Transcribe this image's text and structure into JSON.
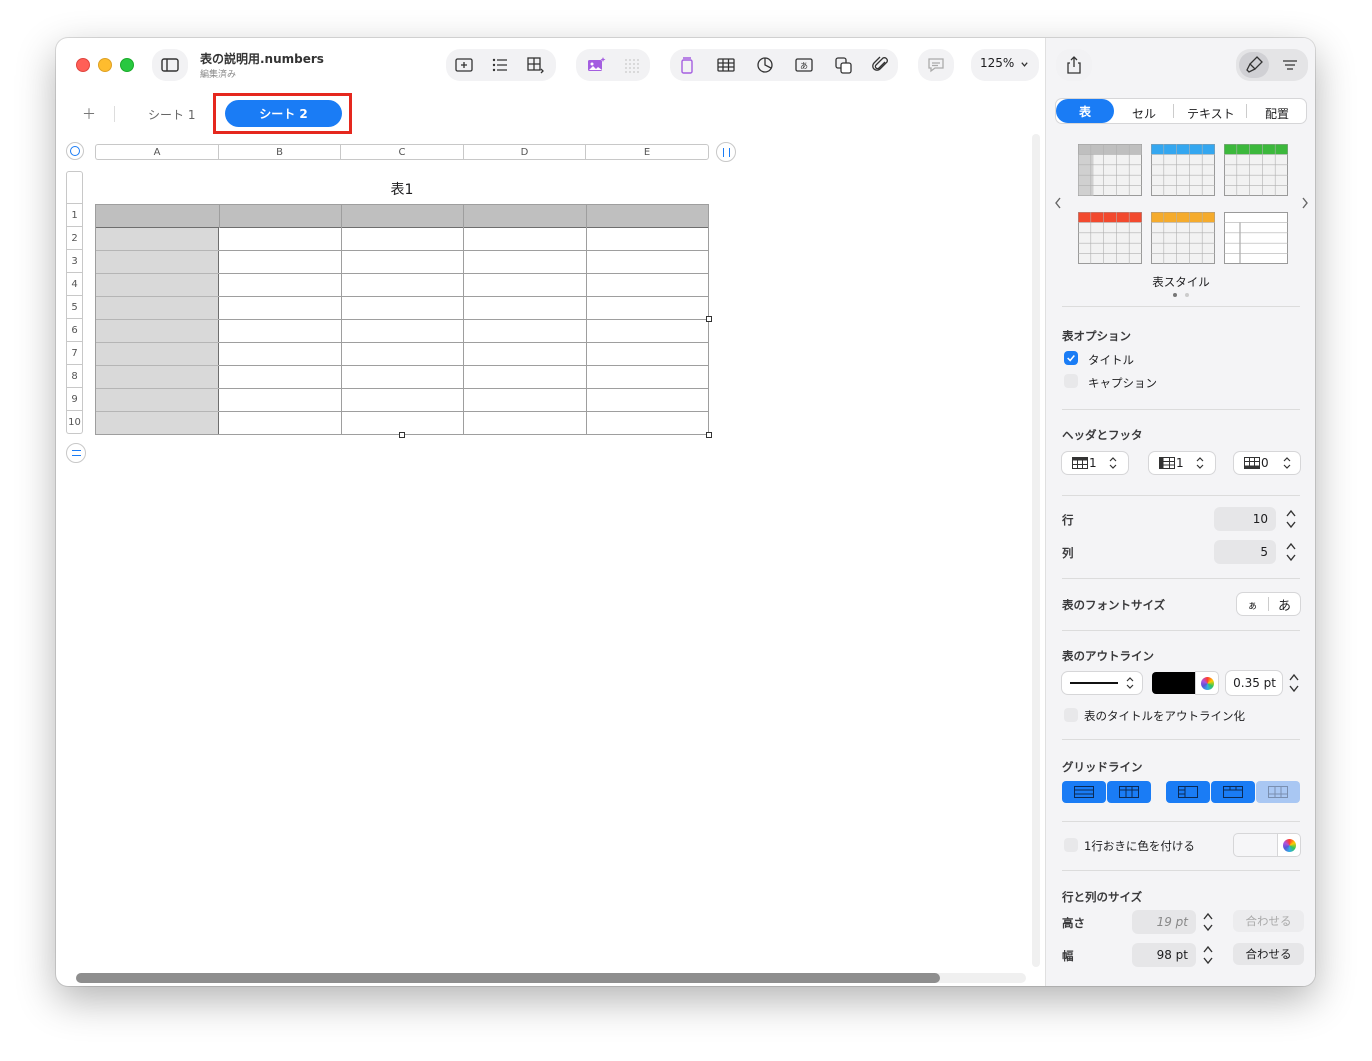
{
  "window": {
    "doc_title": "表の説明用.numbers",
    "doc_subtitle": "編集済み",
    "zoom": "125%"
  },
  "sheets": {
    "add_label": "＋",
    "tabs": [
      {
        "label": "シート 1",
        "selected": false
      },
      {
        "label": "シート 2",
        "selected": true
      }
    ]
  },
  "table": {
    "title": "表1",
    "columns": [
      "A",
      "B",
      "C",
      "D",
      "E"
    ],
    "rows": [
      "1",
      "2",
      "3",
      "4",
      "5",
      "6",
      "7",
      "8",
      "9",
      "10"
    ]
  },
  "sidebar": {
    "tabs": [
      {
        "label": "表",
        "selected": true
      },
      {
        "label": "セル",
        "selected": false
      },
      {
        "label": "テキスト",
        "selected": false
      },
      {
        "label": "配置",
        "selected": false
      }
    ],
    "styles_label": "表スタイル",
    "style_colors": [
      "#bfbfbf",
      "#34a7f0",
      "#3cb83c",
      "#f2492e",
      "#f5ab2c",
      "#ffffff"
    ],
    "table_options": {
      "label": "表オプション",
      "title_label": "タイトル",
      "title_checked": true,
      "caption_label": "キャプション",
      "caption_checked": false
    },
    "headers_footers": {
      "label": "ヘッダとフッタ",
      "header_rows": "1",
      "header_cols": "1",
      "footer_rows": "0"
    },
    "rows_label": "行",
    "rows_value": "10",
    "cols_label": "列",
    "cols_value": "5",
    "font_size": {
      "label": "表のフォントサイズ",
      "smaller": "ぁ",
      "larger": "あ"
    },
    "outline": {
      "label": "表のアウトライン",
      "color": "#000000",
      "width": "0.35 pt",
      "outline_title_label": "表のタイトルをアウトライン化"
    },
    "gridlines_label": "グリッドライン",
    "alternate_label": "1行おきに色を付ける",
    "row_col_size": {
      "label": "行と列のサイズ",
      "height_label": "高さ",
      "height_value": "19 pt",
      "width_label": "幅",
      "width_value": "98 pt",
      "fit_label": "合わせる"
    }
  },
  "colors": {
    "accent": "#1a7cf5",
    "highlight": "#e5281e",
    "header_row": "#bfbfbf",
    "header_col": "#d9d9d9"
  }
}
